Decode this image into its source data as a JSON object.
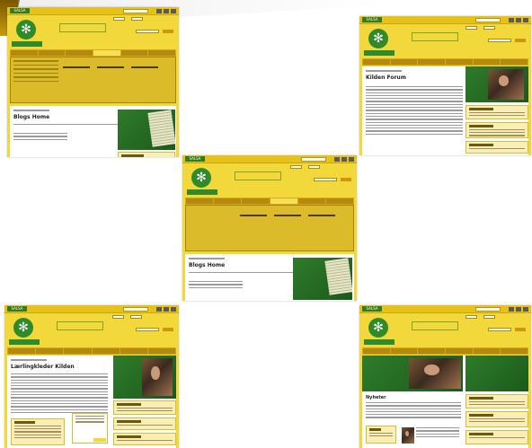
{
  "thumbnails": [
    {
      "id": "top-left",
      "page_title": "Blogs Home",
      "variant": "menu-open"
    },
    {
      "id": "top-right",
      "page_title": "Kilden Forum",
      "variant": "article"
    },
    {
      "id": "center",
      "page_title": "Blogs Home",
      "variant": "menu-open"
    },
    {
      "id": "bottom-left",
      "page_title": "Lærlingkleder Kilden",
      "variant": "article-photo"
    },
    {
      "id": "bottom-right",
      "page_title": "Nyheter",
      "variant": "home"
    }
  ],
  "site": {
    "logo_label": "SALSA",
    "emblem_glyph": "✻",
    "colors": {
      "header": "#e6c219",
      "page": "#f2d83a",
      "green": "#2f8a29",
      "accent": "#c99a10"
    }
  }
}
